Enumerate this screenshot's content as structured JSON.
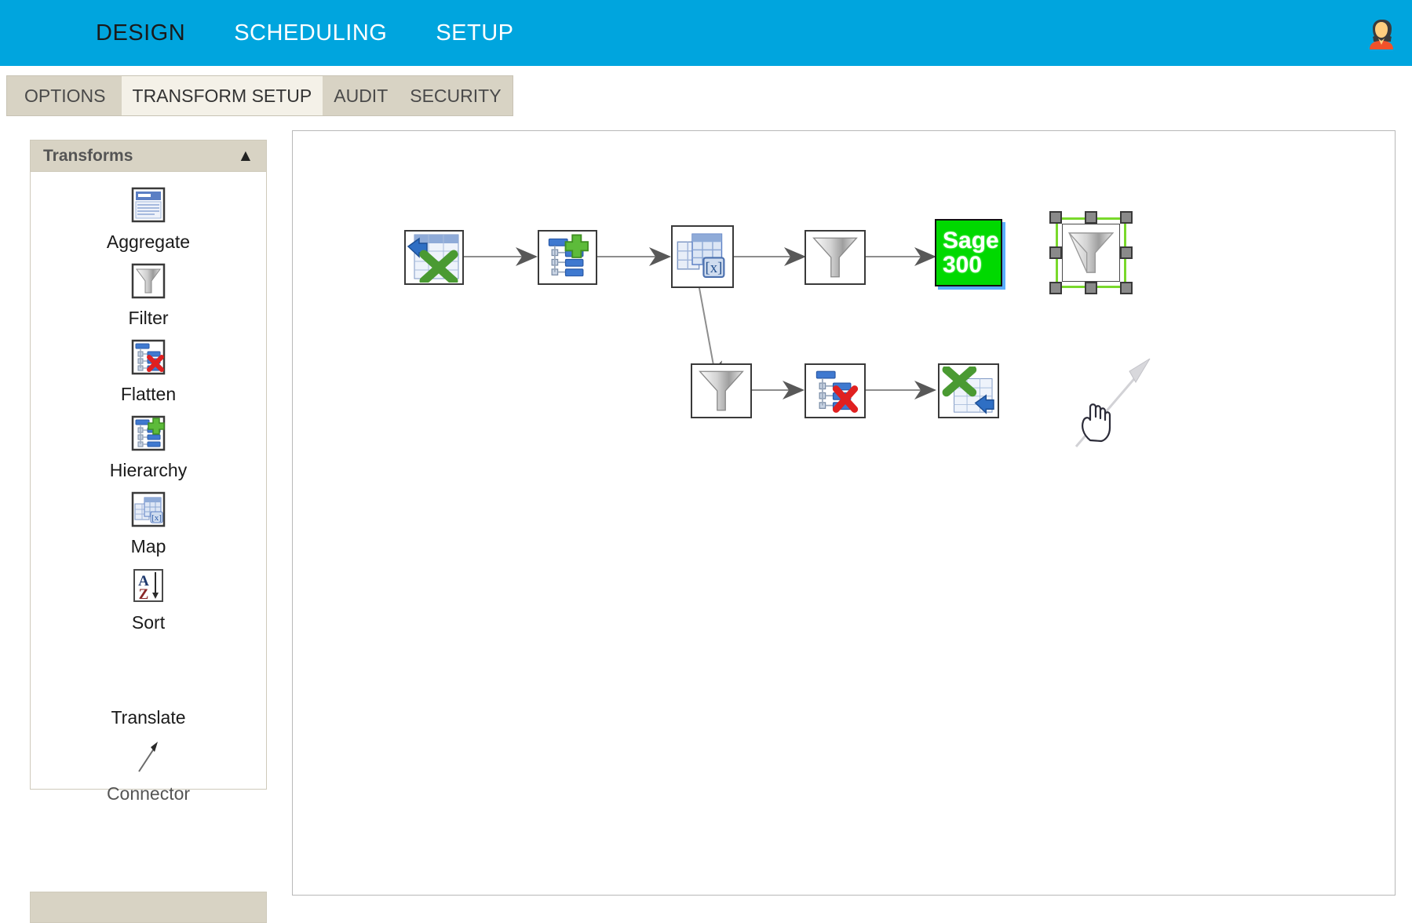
{
  "topnav": {
    "items": [
      {
        "label": "DESIGN",
        "active": true
      },
      {
        "label": "SCHEDULING",
        "active": false
      },
      {
        "label": "SETUP",
        "active": false
      }
    ],
    "avatar_icon": "user-avatar-icon",
    "background_color": "#00a5de"
  },
  "tabs": [
    {
      "label": "OPTIONS",
      "active": false
    },
    {
      "label": "TRANSFORM SETUP",
      "active": true
    },
    {
      "label": "AUDIT",
      "active": false
    },
    {
      "label": "SECURITY",
      "active": false
    }
  ],
  "sidebar": {
    "title": "Transforms",
    "collapse_icon": "double-chevron-up-icon",
    "tools": [
      {
        "label": "Aggregate",
        "icon": "aggregate-icon"
      },
      {
        "label": "Filter",
        "icon": "funnel-icon"
      },
      {
        "label": "Flatten",
        "icon": "flatten-icon"
      },
      {
        "label": "Hierarchy",
        "icon": "hierarchy-icon"
      },
      {
        "label": "Map",
        "icon": "map-table-icon"
      },
      {
        "label": "Sort",
        "icon": "sort-az-icon"
      },
      {
        "label": "Translate",
        "icon": "missing-icon"
      },
      {
        "label": "Connector",
        "icon": "connector-arrow-icon"
      }
    ]
  },
  "canvas": {
    "nodes": [
      {
        "id": "excel-import",
        "name": "excel-import-node",
        "icon": "excel-import-icon",
        "selected": false
      },
      {
        "id": "hierarchy-1",
        "name": "hierarchy-node",
        "icon": "hierarchy-icon",
        "selected": false
      },
      {
        "id": "map-1",
        "name": "map-node",
        "icon": "map-table-icon",
        "selected": false
      },
      {
        "id": "filter-1",
        "name": "filter-node",
        "icon": "funnel-icon",
        "selected": false
      },
      {
        "id": "sage300",
        "name": "sage300-node",
        "icon": "sage300-icon",
        "selected": false
      },
      {
        "id": "filter-selected",
        "name": "filter-node-selected",
        "icon": "funnel-icon",
        "selected": true
      },
      {
        "id": "filter-2",
        "name": "filter-node-2",
        "icon": "funnel-icon",
        "selected": false
      },
      {
        "id": "flatten-1",
        "name": "flatten-node",
        "icon": "flatten-icon",
        "selected": false
      },
      {
        "id": "excel-export",
        "name": "excel-export-node",
        "icon": "excel-export-icon",
        "selected": false
      }
    ],
    "sage300": {
      "line1": "Sage",
      "line2": "300",
      "color": "#00d900"
    },
    "selection_color": "#79d92b",
    "drag_ghost_icon": "ghost-connector-arrow",
    "cursor_icon": "pointing-hand-cursor"
  }
}
